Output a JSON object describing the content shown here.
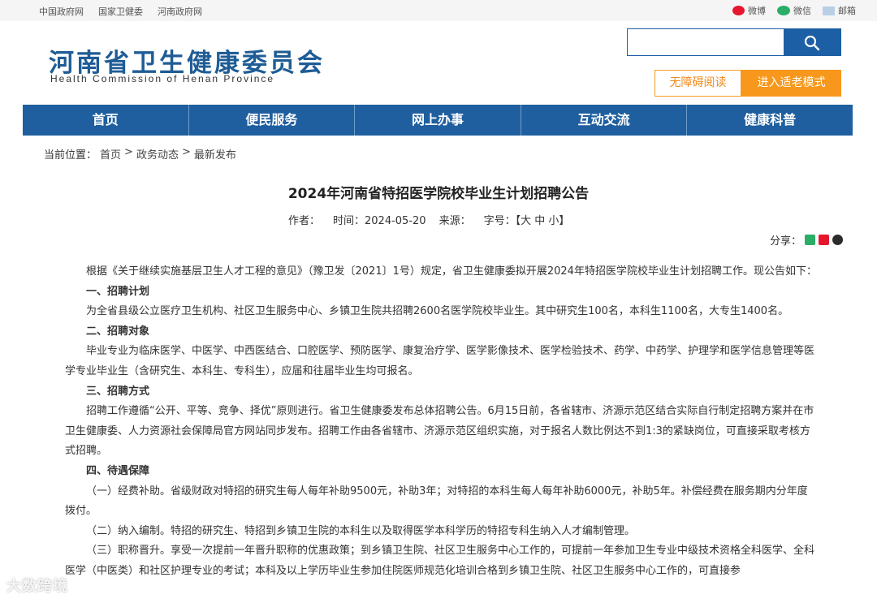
{
  "topbar": {
    "links": [
      "中国政府网",
      "国家卫健委",
      "河南政府网"
    ],
    "social": [
      {
        "label": "微博",
        "icon": "weibo-icon"
      },
      {
        "label": "微信",
        "icon": "wechat-icon"
      },
      {
        "label": "邮箱",
        "icon": "mail-icon"
      }
    ]
  },
  "header": {
    "logo_cn": "河南省卫生健康委员会",
    "logo_en": "Health Commission of Henan Province",
    "search_placeholder": "",
    "accessible_label": "无障碍阅读",
    "elder_mode_label": "进入适老模式"
  },
  "nav": [
    "首页",
    "便民服务",
    "网上办事",
    "互动交流",
    "健康科普"
  ],
  "breadcrumb": {
    "prefix": "当前位置：",
    "items": [
      "首页",
      "政务动态",
      "最新发布"
    ],
    "separator": ">"
  },
  "article": {
    "title": "2024年河南省特招医学院校毕业生计划招聘公告",
    "author_label": "作者：",
    "time_label": "时间：2024-05-20",
    "source_label": "来源：",
    "fontsize_label": "字号：【大 中 小】",
    "share_label": "分享：",
    "paragraphs": [
      {
        "type": "p",
        "text": "根据《关于继续实施基层卫生人才工程的意见》（豫卫发〔2021〕1号）规定，省卫生健康委拟开展2024年特招医学院校毕业生计划招聘工作。现公告如下："
      },
      {
        "type": "h",
        "text": "一、招聘计划"
      },
      {
        "type": "p",
        "text": "为全省县级公立医疗卫生机构、社区卫生服务中心、乡镇卫生院共招聘2600名医学院校毕业生。其中研究生100名，本科生1100名，大专生1400名。"
      },
      {
        "type": "h",
        "text": "二、招聘对象"
      },
      {
        "type": "p",
        "text": "毕业专业为临床医学、中医学、中西医结合、口腔医学、预防医学、康复治疗学、医学影像技术、医学检验技术、药学、中药学、护理学和医学信息管理等医学专业毕业生（含研究生、本科生、专科生），应届和往届毕业生均可报名。"
      },
      {
        "type": "h",
        "text": "三、招聘方式"
      },
      {
        "type": "p",
        "text": "招聘工作遵循“公开、平等、竞争、择优”原则进行。省卫生健康委发布总体招聘公告。6月15日前，各省辖市、济源示范区结合实际自行制定招聘方案并在市卫生健康委、人力资源社会保障局官方网站同步发布。招聘工作由各省辖市、济源示范区组织实施，对于报名人数比例达不到1:3的紧缺岗位，可直接采取考核方式招聘。"
      },
      {
        "type": "h",
        "text": "四、待遇保障"
      },
      {
        "type": "p",
        "text": "（一）经费补助。省级财政对特招的研究生每人每年补助9500元，补助3年；对特招的本科生每人每年补助6000元，补助5年。补偿经费在服务期内分年度拨付。"
      },
      {
        "type": "p",
        "text": "（二）纳入编制。特招的研究生、特招到乡镇卫生院的本科生以及取得医学本科学历的特招专科生纳入人才编制管理。"
      },
      {
        "type": "p",
        "text": "（三）职称晋升。享受一次提前一年晋升职称的优惠政策；到乡镇卫生院、社区卫生服务中心工作的，可提前一年参加卫生专业中级技术资格全科医学、全科医学（中医类）和社区护理专业的考试；本科及以上学历毕业生参加住院医师规范化培训合格到乡镇卫生院、社区卫生服务中心工作的，可直接参"
      }
    ]
  },
  "watermark": "大数跨境",
  "colors": {
    "brand_blue": "#1f5f9f",
    "accent_orange": "#f7981d"
  }
}
